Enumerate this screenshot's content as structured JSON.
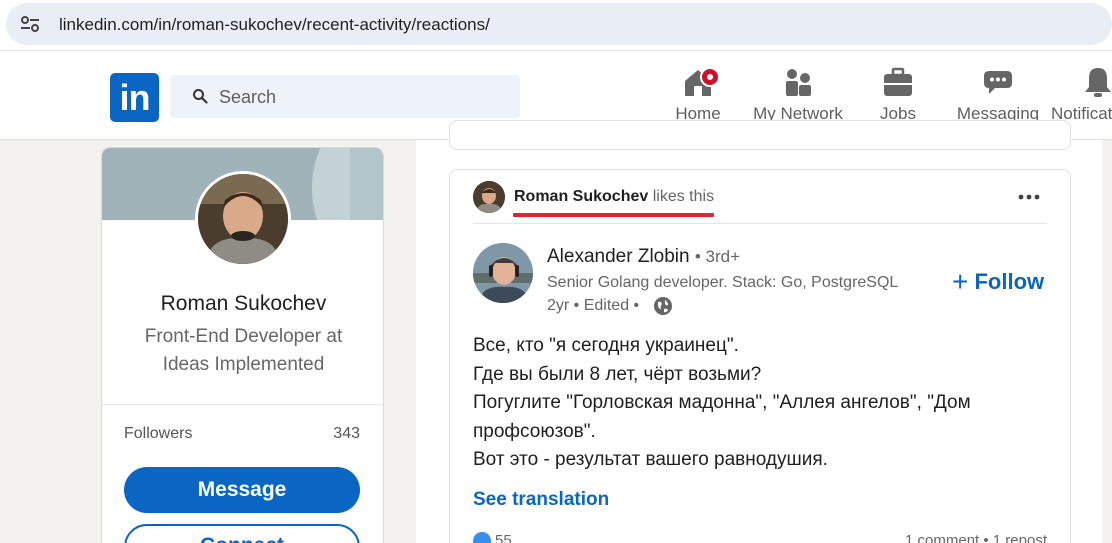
{
  "browser": {
    "url": "linkedin.com/in/roman-sukochev/recent-activity/reactions/"
  },
  "nav": {
    "logo_text": "in",
    "search_placeholder": "Search",
    "items": [
      {
        "label": "Home",
        "icon": "home-icon"
      },
      {
        "label": "My Network",
        "icon": "my-network-icon"
      },
      {
        "label": "Jobs",
        "icon": "jobs-icon"
      },
      {
        "label": "Messaging",
        "icon": "messaging-icon"
      },
      {
        "label": "Notificat",
        "icon": "notifications-icon"
      }
    ],
    "accent": "#0a66c2",
    "notification_color": "#cb112d"
  },
  "profile": {
    "name": "Roman Sukochev",
    "headline": "Front-End Developer at Ideas Implemented",
    "followers_label": "Followers",
    "followers_count": "343",
    "message_label": "Message",
    "connect_label": "Connect"
  },
  "activity": {
    "actor": "Roman Sukochev",
    "verb": "likes this",
    "highlight_color": "#e0262e"
  },
  "post": {
    "author_name": "Alexander Zlobin",
    "author_degree": "• 3rd+",
    "author_headline": "Senior Golang developer. Stack: Go, PostgreSQL",
    "time": "2yr • Edited •",
    "follow_label": "Follow",
    "body_lines": [
      "Все, кто \"я сегодня украинец\".",
      "Где вы были 8 лет, чёрт возьми?",
      "Погуглите \"Горловская мадонна\", \"Аллея ангелов\", \"Дом профсоюзов\".",
      "Вот это - результат вашего равнодушия."
    ],
    "see_translation": "See translation",
    "reaction_count": "55",
    "social_counts": "1 comment • 1 repost"
  }
}
